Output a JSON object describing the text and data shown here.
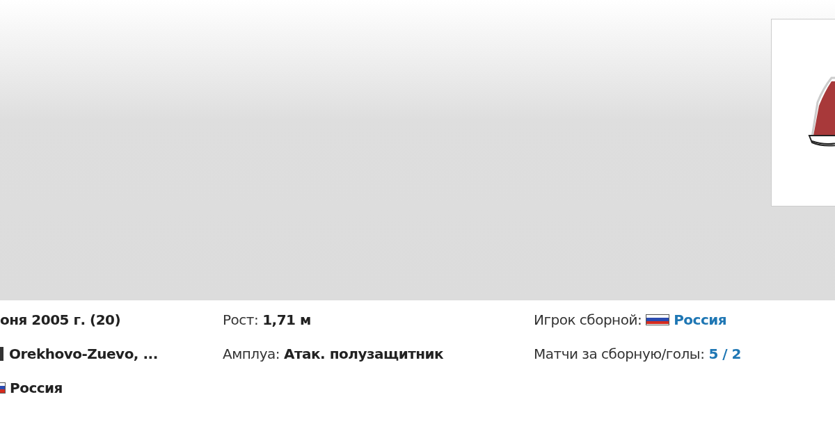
{
  "info_columns": [
    [
      {
        "kind": "text",
        "value": "оня 2005 г. (20)"
      },
      {
        "kind": "emblem",
        "value": "Orekhovo-Zuevo, ..."
      },
      {
        "kind": "flag",
        "value": "Россия"
      }
    ],
    [
      {
        "kind": "text",
        "label": "Рост:",
        "value": "1,71 м"
      },
      {
        "kind": "text",
        "label": "Амплуа:",
        "value": "Атак. полузащитник"
      }
    ],
    [
      {
        "kind": "flag_link",
        "label": "Игрок сборной:",
        "value": "Россия"
      },
      {
        "kind": "link",
        "label": "Матчи за сборную/голы:",
        "value": "5 / 2"
      }
    ]
  ]
}
